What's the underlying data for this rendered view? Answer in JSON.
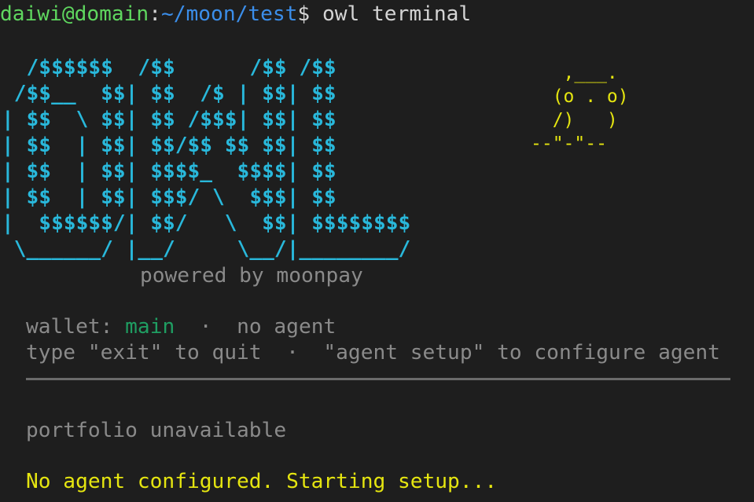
{
  "colors": {
    "background": "#1e1e1e",
    "user_host": "#5fd75f",
    "path": "#3b8eea",
    "text": "#d4d4d4",
    "logo": "#29b8db",
    "owl": "#e5e510",
    "muted": "#8a8a8a",
    "wallet_name": "#1f9e62",
    "warning": "#e5e510"
  },
  "prompt": {
    "user_host": "daiwi@domain",
    "separator": ":",
    "path": "~/moon/test",
    "symbol": "$",
    "command": " owl terminal"
  },
  "banner": {
    "logo_lines": [
      "  /$$$$$$  /$$      /$$ /$$",
      " /$$__  $$| $$  /$ | $$| $$",
      "| $$  \\ $$| $$ /$$$| $$| $$",
      "| $$  | $$| $$/$$ $$ $$| $$",
      "| $$  | $$| $$$$_  $$$$| $$",
      "| $$  | $$| $$$/ \\  $$$| $$",
      "|  $$$$$$/| $$/   \\  $$| $$$$$$$$",
      " \\______/ |__/     \\__/|________/"
    ],
    "owl_lines": [
      "   ,___.",
      "  (o . o)",
      "  /)   )",
      "--\"-\"--"
    ],
    "powered_by": "powered by moonpay"
  },
  "status": {
    "wallet_label": "wallet:",
    "wallet_name": "main",
    "dot": "·",
    "agent_status": "no agent",
    "help_text": "type \"exit\" to quit  ·  \"agent setup\" to configure agent"
  },
  "output": {
    "portfolio": "portfolio unavailable",
    "setup_message": "No agent configured. Starting setup..."
  }
}
